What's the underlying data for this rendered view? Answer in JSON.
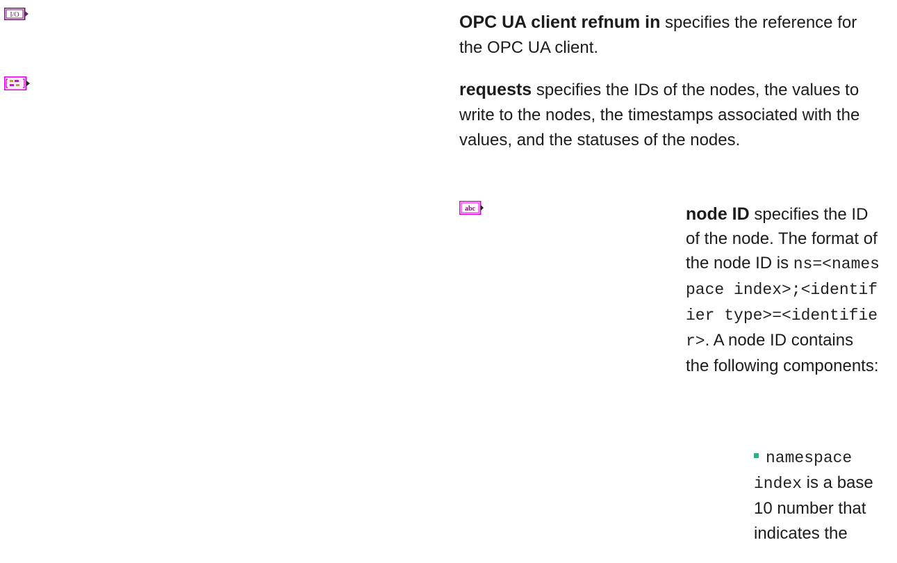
{
  "params": [
    {
      "icon": "io-refnum-icon",
      "icon_text": "I/O",
      "name": "OPC UA client refnum in",
      "description": " specifies the reference for the OPC UA client."
    },
    {
      "icon": "cluster-array-icon",
      "icon_text": "",
      "name": "requests",
      "description": " specifies the IDs of the nodes, the values to write to the nodes, the timestamps associated with the values, and the statuses of the nodes."
    }
  ],
  "sub_params": [
    {
      "icon": "string-abc-icon",
      "icon_text": "abc",
      "name": "node ID",
      "desc_1": " specifies the ID of the node. The format of the node ID is ",
      "code_1": "ns=<namespace index>;<identifier type>=<identifier>",
      "desc_2": ". A node ID contains the following components:"
    }
  ],
  "bullets": [
    {
      "code": "namespace index",
      "text": " is a base 10 number that indicates the"
    }
  ],
  "colors": {
    "refnum_border": "#6b1f66",
    "cluster_pink": "#e000e0",
    "string_pink": "#e000e0",
    "bullet_green": "#27b38a"
  }
}
